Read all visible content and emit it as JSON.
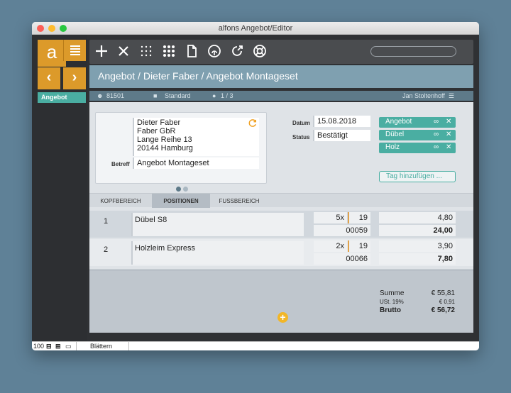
{
  "window": {
    "title": "alfons Angebot/Editor"
  },
  "sidebar": {
    "logo": "a",
    "active_item": "Angebot"
  },
  "toolbar": {
    "icons": [
      "add-icon",
      "delete-icon",
      "dots-grid-icon",
      "apps-grid-icon",
      "document-icon",
      "fingerprint-icon",
      "share-icon",
      "lifebuoy-icon"
    ],
    "search_value": ""
  },
  "breadcrumb": "Angebot / Dieter Faber / Angebot Montageset",
  "infobar": {
    "customer_no": "81501",
    "folder": "Standard",
    "position": "1 / 3",
    "user": "Jan Stoltenhoff"
  },
  "address": {
    "lines": [
      "Dieter Faber",
      "Faber GbR",
      "Lange Reihe 13",
      "20144 Hamburg"
    ],
    "betreff_label": "Betreff",
    "betreff": "Angebot Montageset"
  },
  "meta": {
    "datum_label": "Datum",
    "datum": "15.08.2018",
    "status_label": "Status",
    "status": "Bestätigt"
  },
  "tags": {
    "items": [
      "Angebot",
      "Dübel",
      "Holz"
    ],
    "add_label": "Tag hinzufügen ..."
  },
  "tabs": [
    "KOPFBEREICH",
    "POSITIONEN",
    "FUSSBEREICH"
  ],
  "positions": [
    {
      "nr": "1",
      "name": "Dübel S8",
      "qty": "5x",
      "unit": "19",
      "article": "00059",
      "price": "4,80",
      "total": "24,00"
    },
    {
      "nr": "2",
      "name": "Holzleim Express",
      "qty": "2x",
      "unit": "19",
      "article": "00066",
      "price": "3,90",
      "total": "7,80"
    }
  ],
  "totals": {
    "summe_label": "Summe",
    "summe": "€ 55,81",
    "ust_label": "USt. 19%",
    "ust": "€ 0,91",
    "brutto_label": "Brutto",
    "brutto": "€ 56,72"
  },
  "statusbar": {
    "zoom": "100",
    "mode": "Blättern"
  },
  "colors": {
    "accent": "#dc9a2a",
    "teal": "#4aaea2",
    "header_blue": "#7fa0b0"
  }
}
